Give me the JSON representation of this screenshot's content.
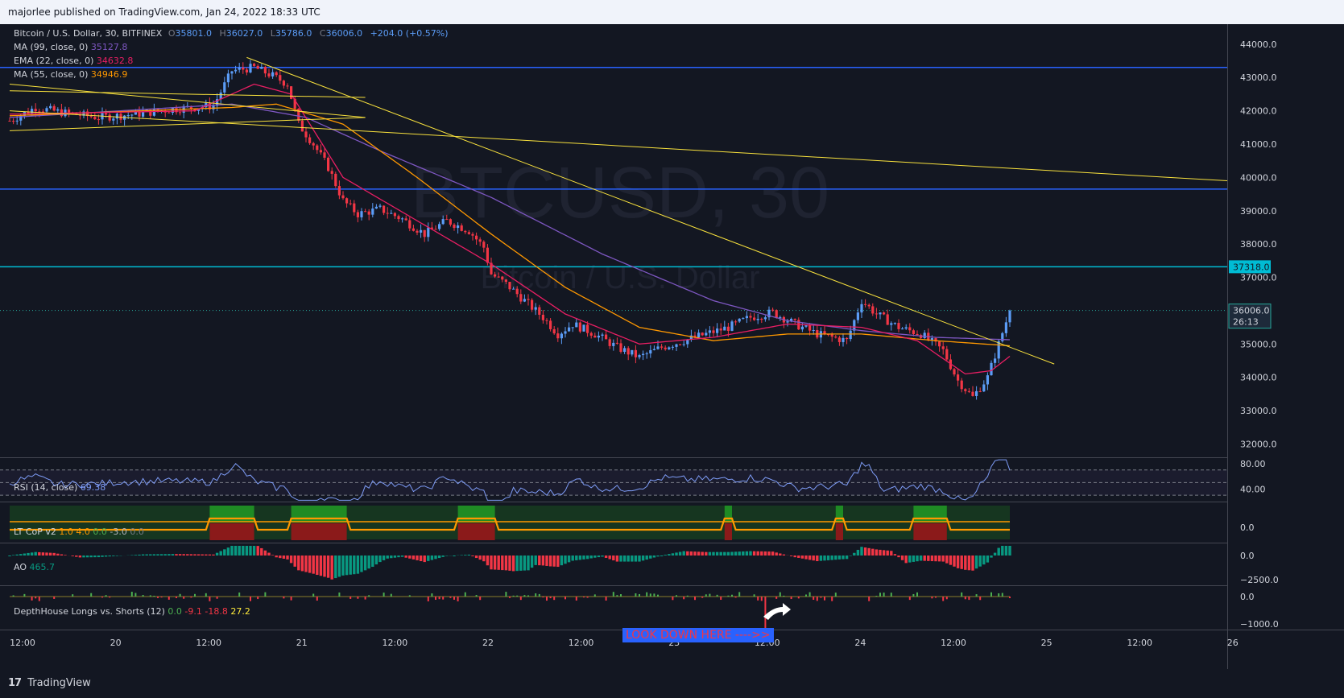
{
  "header": {
    "publish_text": "majorlee published on TradingView.com, Jan 24, 2022 18:33 UTC"
  },
  "footer": {
    "brand": "TradingView",
    "logo_glyph": "17"
  },
  "watermark": {
    "symbol": "BTCUSD, 30",
    "name": "Bitcoin / U.S. Dollar"
  },
  "legend": {
    "symbol": "Bitcoin / U.S. Dollar, 30, BITFINEX",
    "o_key": "O",
    "o": "35801.0",
    "h_key": "H",
    "h": "36027.0",
    "l_key": "L",
    "l": "35786.0",
    "c_key": "C",
    "c": "36006.0",
    "change": "+204.0 (+0.57%)",
    "ma99_label": "MA (99, close, 0)",
    "ma99_value": "35127.8",
    "ema22_label": "EMA (22, close, 0)",
    "ema22_value": "34632.8",
    "ma55_label": "MA (55, close, 0)",
    "ma55_value": "34946.9"
  },
  "annotations": {
    "look_down": "LOOK DOWN HERE ---->>"
  },
  "indicators": {
    "rsi": {
      "label": "RSI (14, close)",
      "value": "69.38",
      "ticks": [
        "80.00",
        "40.00"
      ]
    },
    "ltcop": {
      "label": "LT CoP v2",
      "values": [
        "1.0",
        "4.0",
        "0.0",
        "-3.0",
        "0.0"
      ],
      "ticks": [
        "0.0"
      ]
    },
    "ao": {
      "label": "AO",
      "value": "465.7",
      "ticks": [
        "0.0",
        "−2500.0"
      ]
    },
    "depth": {
      "label": "DepthHouse Longs vs. Shorts (12)",
      "values": [
        "0.0",
        "-9.1",
        "-18.8",
        "27.2"
      ],
      "ticks": [
        "0.0",
        "−1000.0"
      ]
    }
  },
  "colors": {
    "background": "#131722",
    "up": "#5b9cf6",
    "down": "#f23645",
    "ma99": "#7e57c2",
    "ema22": "#e91e63",
    "ma55": "#ff9800",
    "trendline": "#f9e23d",
    "hline": "#2962ff",
    "cyan": "#00bcd4"
  },
  "chart_data": {
    "type": "candlestick",
    "title": "Bitcoin / U.S. Dollar, 30, BITFINEX",
    "interval": "30",
    "x_labels": [
      "12:00",
      "20",
      "12:00",
      "21",
      "12:00",
      "22",
      "12:00",
      "23",
      "12:00",
      "24",
      "12:00",
      "25",
      "12:00",
      "26"
    ],
    "y_ticks": [
      "44000.0",
      "43000.0",
      "42000.0",
      "41000.0",
      "40000.0",
      "39000.0",
      "38000.0",
      "37000.0",
      "35000.0",
      "34000.0",
      "33000.0",
      "32000.0"
    ],
    "ylim": [
      31600,
      44600
    ],
    "price_label": {
      "value": "36006.0",
      "countdown": "26:13"
    },
    "cyan_label": "37318.0",
    "horizontal_lines": [
      43300,
      39650,
      37318
    ],
    "last_price": 36006,
    "price_anchors": [
      [
        0,
        41700
      ],
      [
        7,
        42100
      ],
      [
        14,
        41950
      ],
      [
        24,
        41800
      ],
      [
        34,
        41900
      ],
      [
        44,
        42050
      ],
      [
        55,
        42150
      ],
      [
        60,
        43200
      ],
      [
        66,
        43300
      ],
      [
        71,
        43050
      ],
      [
        75,
        42800
      ],
      [
        78,
        41600
      ],
      [
        82,
        41000
      ],
      [
        86,
        40300
      ],
      [
        90,
        39300
      ],
      [
        94,
        38900
      ],
      [
        100,
        39050
      ],
      [
        106,
        38750
      ],
      [
        112,
        38300
      ],
      [
        118,
        38700
      ],
      [
        124,
        38400
      ],
      [
        128,
        37900
      ],
      [
        130,
        37100
      ],
      [
        134,
        36800
      ],
      [
        140,
        36200
      ],
      [
        144,
        35800
      ],
      [
        148,
        35300
      ],
      [
        152,
        35600
      ],
      [
        158,
        35300
      ],
      [
        164,
        34900
      ],
      [
        170,
        34600
      ],
      [
        176,
        34900
      ],
      [
        182,
        35100
      ],
      [
        188,
        35300
      ],
      [
        194,
        35500
      ],
      [
        200,
        35800
      ],
      [
        206,
        35950
      ],
      [
        212,
        35600
      ],
      [
        218,
        35300
      ],
      [
        226,
        35100
      ],
      [
        230,
        36300
      ],
      [
        234,
        35900
      ],
      [
        240,
        35500
      ],
      [
        246,
        35300
      ],
      [
        252,
        34800
      ],
      [
        256,
        33900
      ],
      [
        260,
        33400
      ],
      [
        264,
        34000
      ],
      [
        267,
        35000
      ],
      [
        270,
        36006
      ]
    ],
    "ma99_anchors": [
      [
        0,
        41800
      ],
      [
        60,
        42200
      ],
      [
        80,
        41800
      ],
      [
        100,
        40800
      ],
      [
        130,
        39400
      ],
      [
        160,
        37700
      ],
      [
        190,
        36300
      ],
      [
        210,
        35700
      ],
      [
        230,
        35400
      ],
      [
        250,
        35200
      ],
      [
        270,
        35128
      ]
    ],
    "ema22_anchors": [
      [
        0,
        41900
      ],
      [
        50,
        42000
      ],
      [
        66,
        42800
      ],
      [
        76,
        42500
      ],
      [
        90,
        40000
      ],
      [
        110,
        38700
      ],
      [
        130,
        37400
      ],
      [
        150,
        35900
      ],
      [
        170,
        35000
      ],
      [
        190,
        35200
      ],
      [
        210,
        35600
      ],
      [
        230,
        35500
      ],
      [
        245,
        35100
      ],
      [
        258,
        34100
      ],
      [
        265,
        34200
      ],
      [
        270,
        34633
      ]
    ],
    "ma55_anchors": [
      [
        0,
        41850
      ],
      [
        60,
        42100
      ],
      [
        72,
        42200
      ],
      [
        90,
        41600
      ],
      [
        110,
        40000
      ],
      [
        130,
        38300
      ],
      [
        150,
        36700
      ],
      [
        170,
        35500
      ],
      [
        190,
        35100
      ],
      [
        210,
        35300
      ],
      [
        230,
        35300
      ],
      [
        250,
        35100
      ],
      [
        270,
        34947
      ]
    ],
    "trendlines": [
      {
        "from": [
          0,
          42600
        ],
        "to": [
          96,
          42400
        ]
      },
      {
        "from": [
          0,
          42800
        ],
        "to": [
          96,
          41800
        ]
      },
      {
        "from": [
          0,
          41400
        ],
        "to": [
          96,
          41800
        ]
      },
      {
        "from": [
          64,
          43600
        ],
        "to": [
          282,
          34400
        ]
      },
      {
        "from": [
          0,
          42000
        ],
        "to": [
          330,
          39900
        ]
      }
    ]
  }
}
